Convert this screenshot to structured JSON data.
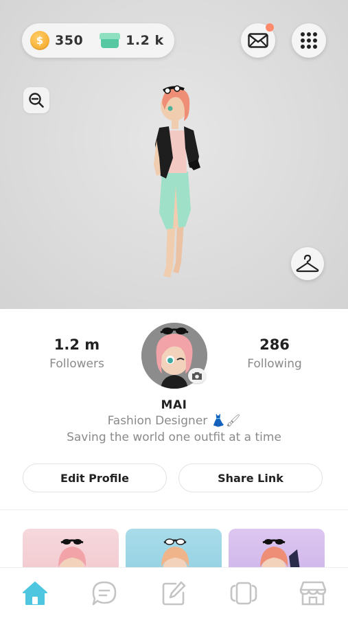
{
  "wallet": {
    "coin_symbol": "$",
    "coins": "350",
    "gems": "1.2 k"
  },
  "header": {
    "has_unread_mail": true
  },
  "profile": {
    "followers_count": "1.2 m",
    "followers_label": "Followers",
    "following_count": "286",
    "following_label": "Following",
    "name": "MAI",
    "bio_line1": "Fashion Designer 👗🖌",
    "bio_line2": "Saving the world one outfit at a time",
    "edit_button": "Edit Profile",
    "share_button": "Share Link"
  },
  "nav": {
    "items": [
      "home-icon",
      "chat-icon",
      "edit-icon",
      "cards-icon",
      "store-icon"
    ],
    "active": "home-icon"
  },
  "colors": {
    "accent": "#4fc6e0",
    "notification": "#ff8a6b",
    "coin": "#f4a21c",
    "gem": "#56c9a2"
  }
}
